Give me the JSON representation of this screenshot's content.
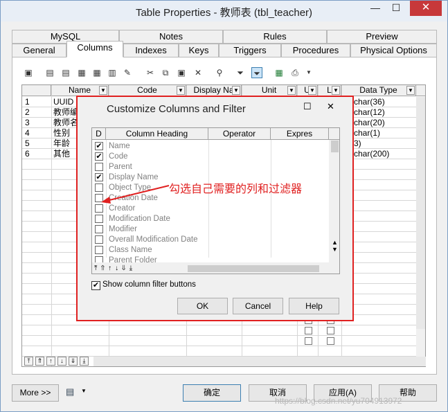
{
  "window": {
    "title": "Table Properties - 教师表 (tbl_teacher)",
    "min_glyph": "—",
    "max_glyph": "☐",
    "close_glyph": "✕"
  },
  "tabs_row1": [
    "MySQL",
    "Notes",
    "Rules",
    "Preview"
  ],
  "tabs_row2": [
    "General",
    "Columns",
    "Indexes",
    "Keys",
    "Triggers",
    "Procedures",
    "Physical Options"
  ],
  "active_tab": "Columns",
  "grid": {
    "headers": [
      "Name",
      "Code",
      "Display Na",
      "Unit",
      "U",
      "L",
      "Data Type"
    ],
    "rows": [
      {
        "num": "1",
        "name": "UUID",
        "type": "char(36)"
      },
      {
        "num": "2",
        "name": "教师编",
        "type": "char(12)"
      },
      {
        "num": "3",
        "name": "教师名",
        "type": "char(20)"
      },
      {
        "num": "4",
        "name": "性别",
        "type": "char(1)"
      },
      {
        "num": "5",
        "name": "年龄",
        "type": "3)"
      },
      {
        "num": "6",
        "name": "其他",
        "type": "char(200)"
      }
    ]
  },
  "dialog": {
    "title": "Customize Columns and Filter",
    "headers": [
      "D",
      "Column Heading",
      "Operator",
      "Expres"
    ],
    "items": [
      {
        "label": "Name",
        "checked": true
      },
      {
        "label": "Code",
        "checked": true
      },
      {
        "label": "Parent",
        "checked": false
      },
      {
        "label": "Display Name",
        "checked": true
      },
      {
        "label": "Object Type",
        "checked": false
      },
      {
        "label": "Creation Date",
        "checked": false
      },
      {
        "label": "Creator",
        "checked": false
      },
      {
        "label": "Modification Date",
        "checked": false
      },
      {
        "label": "Modifier",
        "checked": false
      },
      {
        "label": "Overall Modification Date",
        "checked": false
      },
      {
        "label": "Class Name",
        "checked": false
      },
      {
        "label": "Parent Folder",
        "checked": false
      }
    ],
    "show_filter_label": "Show column filter buttons",
    "ok_label": "OK",
    "cancel_label": "Cancel",
    "help_label": "Help",
    "annotation": "勾选自己需要的列和过滤器"
  },
  "footer": {
    "more_label": "More >>",
    "ok_label": "确定",
    "cancel_label": "取消",
    "apply_label": "应用(A)",
    "help_label": "帮助"
  },
  "watermark": "https://blog.csdn.net/yu704913972",
  "colors": {
    "accent": "#e02020",
    "close": "#c7383a",
    "frame": "#7a9cc4"
  }
}
